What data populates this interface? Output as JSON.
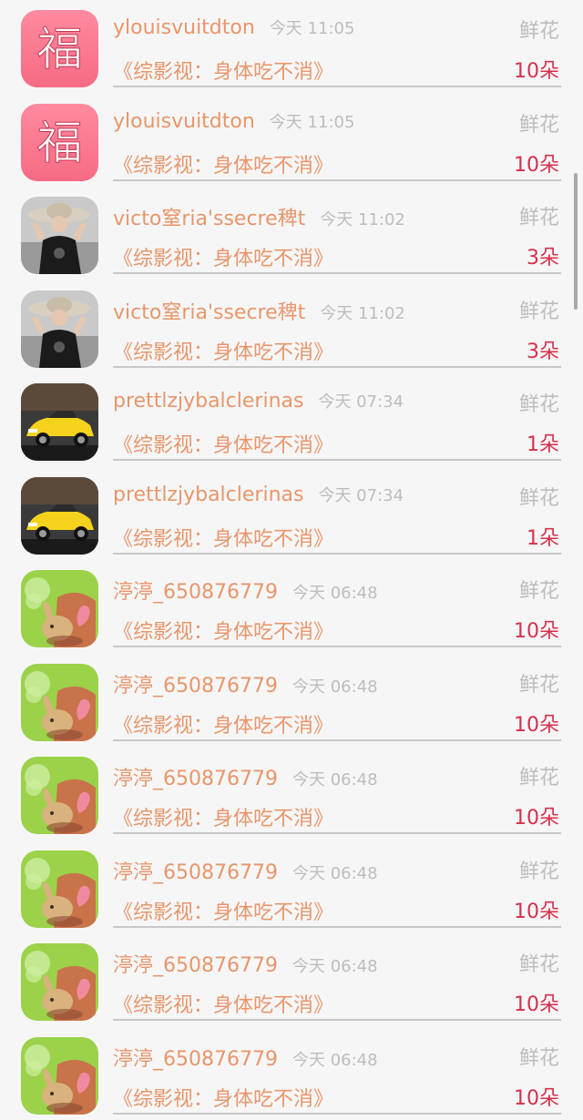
{
  "gifts": [
    {
      "user": "ylouisvuitdton",
      "time": "今天 11:05",
      "gift_type": "鲜花",
      "book": "《综影视：身体吃不消》",
      "quantity": "10朵",
      "avatar": "fu-avatar-icon"
    },
    {
      "user": "ylouisvuitdton",
      "time": "今天 11:05",
      "gift_type": "鲜花",
      "book": "《综影视：身体吃不消》",
      "quantity": "10朵",
      "avatar": "fu-avatar-icon"
    },
    {
      "user": "victo窒ria'ssecre稗t",
      "time": "今天 11:02",
      "gift_type": "鲜花",
      "book": "《综影视：身体吃不消》",
      "quantity": "3朵",
      "avatar": "woman-hat-avatar-icon"
    },
    {
      "user": "victo窒ria'ssecre稗t",
      "time": "今天 11:02",
      "gift_type": "鲜花",
      "book": "《综影视：身体吃不消》",
      "quantity": "3朵",
      "avatar": "woman-hat-avatar-icon"
    },
    {
      "user": "prettlzjybalclerinas",
      "time": "今天 07:34",
      "gift_type": "鲜花",
      "book": "《综影视：身体吃不消》",
      "quantity": "1朵",
      "avatar": "yellow-car-avatar-icon"
    },
    {
      "user": "prettlzjybalclerinas",
      "time": "今天 07:34",
      "gift_type": "鲜花",
      "book": "《综影视：身体吃不消》",
      "quantity": "1朵",
      "avatar": "yellow-car-avatar-icon"
    },
    {
      "user": "渟渟_650876779",
      "time": "今天 06:48",
      "gift_type": "鲜花",
      "book": "《综影视：身体吃不消》",
      "quantity": "10朵",
      "avatar": "bunny-pot-avatar-icon"
    },
    {
      "user": "渟渟_650876779",
      "time": "今天 06:48",
      "gift_type": "鲜花",
      "book": "《综影视：身体吃不消》",
      "quantity": "10朵",
      "avatar": "bunny-pot-avatar-icon"
    },
    {
      "user": "渟渟_650876779",
      "time": "今天 06:48",
      "gift_type": "鲜花",
      "book": "《综影视：身体吃不消》",
      "quantity": "10朵",
      "avatar": "bunny-pot-avatar-icon"
    },
    {
      "user": "渟渟_650876779",
      "time": "今天 06:48",
      "gift_type": "鲜花",
      "book": "《综影视：身体吃不消》",
      "quantity": "10朵",
      "avatar": "bunny-pot-avatar-icon"
    },
    {
      "user": "渟渟_650876779",
      "time": "今天 06:48",
      "gift_type": "鲜花",
      "book": "《综影视：身体吃不消》",
      "quantity": "10朵",
      "avatar": "bunny-pot-avatar-icon"
    },
    {
      "user": "渟渟_650876779",
      "time": "今天 06:48",
      "gift_type": "鲜花",
      "book": "《综影视：身体吃不消》",
      "quantity": "10朵",
      "avatar": "bunny-pot-avatar-icon"
    }
  ],
  "avatar_glyphs": {
    "fu-avatar-icon": "福"
  },
  "colors": {
    "name": "#e8966a",
    "quantity": "#d7304a",
    "muted": "#bdbdbd",
    "fu_bg": "#f56b83"
  }
}
